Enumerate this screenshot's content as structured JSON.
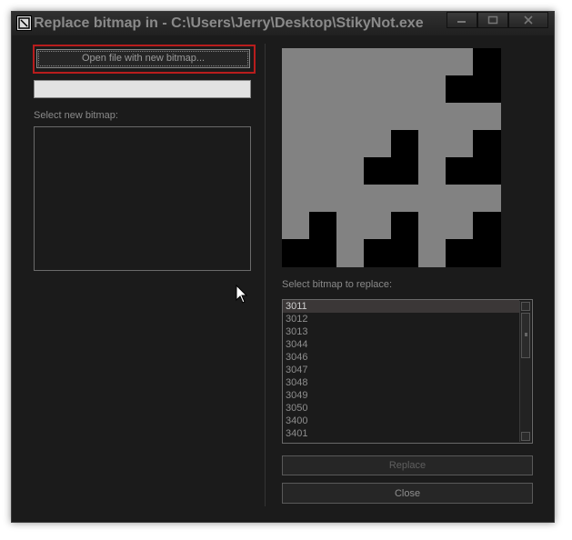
{
  "window": {
    "title": "Replace bitmap in - C:\\Users\\Jerry\\Desktop\\StikyNot.exe",
    "icon": "editor-app-icon"
  },
  "controls": {
    "minimize": "minimize-icon",
    "maximize": "maximize-icon",
    "close": "close-icon"
  },
  "left_panel": {
    "open_button_label": "Open file with new bitmap...",
    "path_value": "",
    "select_new_label": "Select new bitmap:",
    "new_bitmap_items": []
  },
  "right_panel": {
    "select_replace_label": "Select bitmap to replace:",
    "bitmap_ids": [
      "3011",
      "3012",
      "3013",
      "3044",
      "3046",
      "3047",
      "3048",
      "3049",
      "3050",
      "3400",
      "3401"
    ],
    "selected": "3011",
    "replace_button_label": "Replace",
    "close_button_label": "Close"
  },
  "colors": {
    "background": "#1b1b1b",
    "focus_border": "#b81d1d",
    "preview_gray": "#828282",
    "preview_black": "#000000"
  }
}
